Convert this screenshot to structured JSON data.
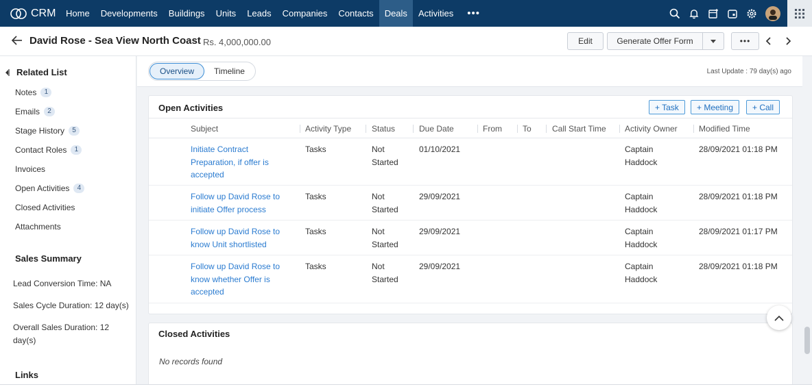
{
  "nav": {
    "brand": "CRM",
    "items": [
      "Home",
      "Developments",
      "Buildings",
      "Units",
      "Leads",
      "Companies",
      "Contacts",
      "Deals",
      "Activities"
    ],
    "active": "Deals",
    "more": "•••"
  },
  "header": {
    "title": "David Rose - Sea View North Coast",
    "amount": "- Rs. 4,000,000.00",
    "edit_label": "Edit",
    "generate_label": "Generate Offer Form",
    "more_label": "•••"
  },
  "sidebar": {
    "related_title": "Related List",
    "related_items": [
      {
        "label": "Notes",
        "badge": "1"
      },
      {
        "label": "Emails",
        "badge": "2"
      },
      {
        "label": "Stage History",
        "badge": "5"
      },
      {
        "label": "Contact Roles",
        "badge": "1"
      },
      {
        "label": "Invoices",
        "badge": ""
      },
      {
        "label": "Open Activities",
        "badge": "4"
      },
      {
        "label": "Closed Activities",
        "badge": ""
      },
      {
        "label": "Attachments",
        "badge": ""
      }
    ],
    "sales_summary_title": "Sales Summary",
    "sales_summary": [
      "Lead Conversion Time: NA",
      "Sales Cycle Duration: 12 day(s)",
      "Overall Sales Duration: 12 day(s)"
    ],
    "links_title": "Links"
  },
  "main": {
    "tabs": [
      "Overview",
      "Timeline"
    ],
    "active_tab": "Overview",
    "last_update": "Last Update : 79 day(s) ago",
    "open_activities": {
      "title": "Open Activities",
      "buttons": [
        "+ Task",
        "+ Meeting",
        "+ Call"
      ],
      "columns": [
        "Subject",
        "Activity Type",
        "Status",
        "Due Date",
        "From",
        "To",
        "Call Start Time",
        "Activity Owner",
        "Modified Time"
      ],
      "rows": [
        {
          "subject": "Initiate Contract Preparation, if offer is accepted",
          "type": "Tasks",
          "status": "Not Started",
          "due": "01/10/2021",
          "owner": "Captain Haddock",
          "modified": "28/09/2021 01:18 PM"
        },
        {
          "subject": "Follow up David Rose to initiate Offer process",
          "type": "Tasks",
          "status": "Not Started",
          "due": "29/09/2021",
          "owner": "Captain Haddock",
          "modified": "28/09/2021 01:18 PM"
        },
        {
          "subject": "Follow up David Rose to know Unit shortlisted",
          "type": "Tasks",
          "status": "Not Started",
          "due": "29/09/2021",
          "owner": "Captain Haddock",
          "modified": "28/09/2021 01:17 PM"
        },
        {
          "subject": "Follow up David Rose to know whether Offer is accepted",
          "type": "Tasks",
          "status": "Not Started",
          "due": "29/09/2021",
          "owner": "Captain Haddock",
          "modified": "28/09/2021 01:18 PM"
        }
      ]
    },
    "closed_activities": {
      "title": "Closed Activities",
      "empty": "No records found"
    }
  },
  "colors": {
    "nav_bg": "#0d3b66",
    "nav_active": "#2d5d88",
    "link": "#2a7bd0",
    "accent": "#3c8dd5"
  }
}
